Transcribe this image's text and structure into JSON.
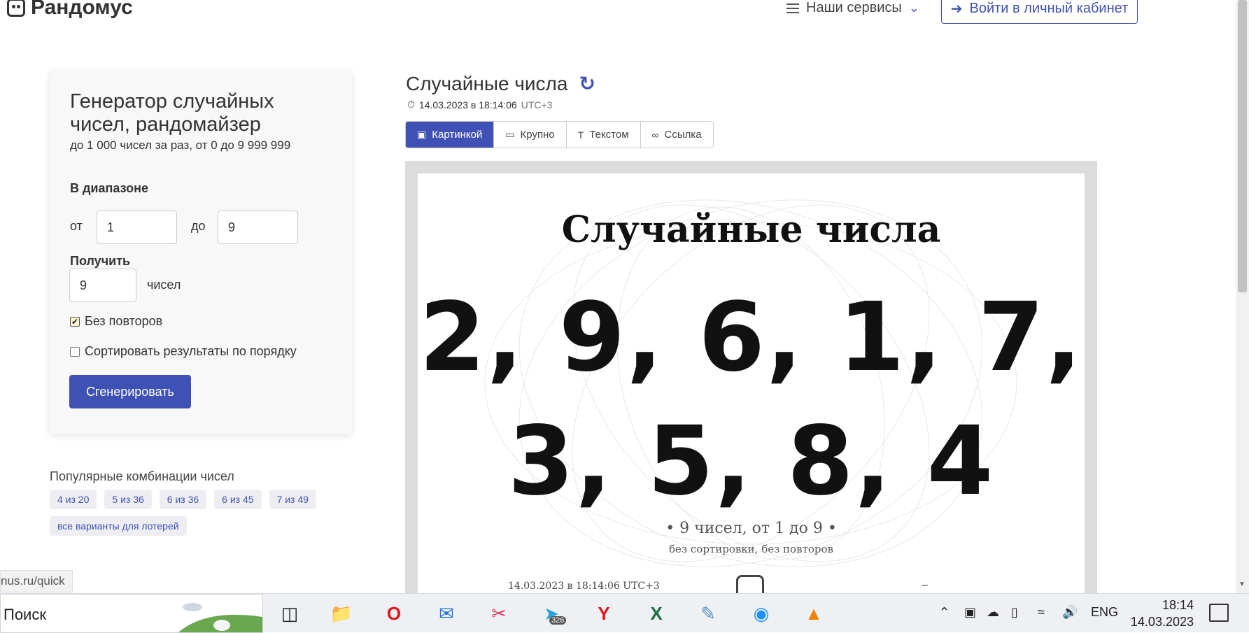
{
  "header": {
    "logo_text": "Рандомус",
    "services_label": "Наши сервисы",
    "login_label": "Войти в личный кабинет"
  },
  "form": {
    "title": "Генератор случайных чисел, рандомайзер",
    "subtitle": "до 1 000 чисел за раз, от 0 до 9 999 999",
    "range_label": "В диапазоне",
    "from_label": "от",
    "from_value": "1",
    "to_label": "до",
    "to_value": "9",
    "get_label": "Получить",
    "count_value": "9",
    "count_unit": "чисел",
    "no_repeat_label": "Без повторов",
    "no_repeat_checked": true,
    "sort_label": "Сортировать результаты по порядку",
    "sort_checked": false,
    "generate_label": "Сгенерировать"
  },
  "popular": {
    "heading": "Популярные комбинации чисел",
    "chips": [
      "4 из 20",
      "5 из 36",
      "6 из 36",
      "6 из 45",
      "7 из 49",
      "все варианты для лотерей"
    ]
  },
  "url_tooltip": "nus.ru/quick",
  "result": {
    "title": "Случайные числа",
    "timestamp": "14.03.2023 в 18:14:06",
    "timezone": "UTC+3",
    "tabs": [
      {
        "label": "Картинкой",
        "icon": "image-icon",
        "active": true
      },
      {
        "label": "Крупно",
        "icon": "rectangle-icon",
        "active": false
      },
      {
        "label": "Текстом",
        "icon": "text-icon",
        "active": false
      },
      {
        "label": "Ссылка",
        "icon": "link-icon",
        "active": false
      }
    ],
    "image": {
      "heading": "Случайные числа",
      "line1": "2, 9, 6, 1, 7,",
      "line2": "3, 5, 8, 4",
      "description": "• 9 чисел, от 1 до 9 •",
      "details": "без сортировки, без повторов",
      "stamp": "14.03.2023 в 18:14:06 UTC+3",
      "dash": "–"
    }
  },
  "taskbar": {
    "search_label": "Поиск",
    "telegram_badge": "326",
    "lang": "ENG",
    "time": "18:14",
    "date": "14.03.2023"
  },
  "colors": {
    "accent": "#3f51b5",
    "card_bg": "#f8f8f8"
  }
}
